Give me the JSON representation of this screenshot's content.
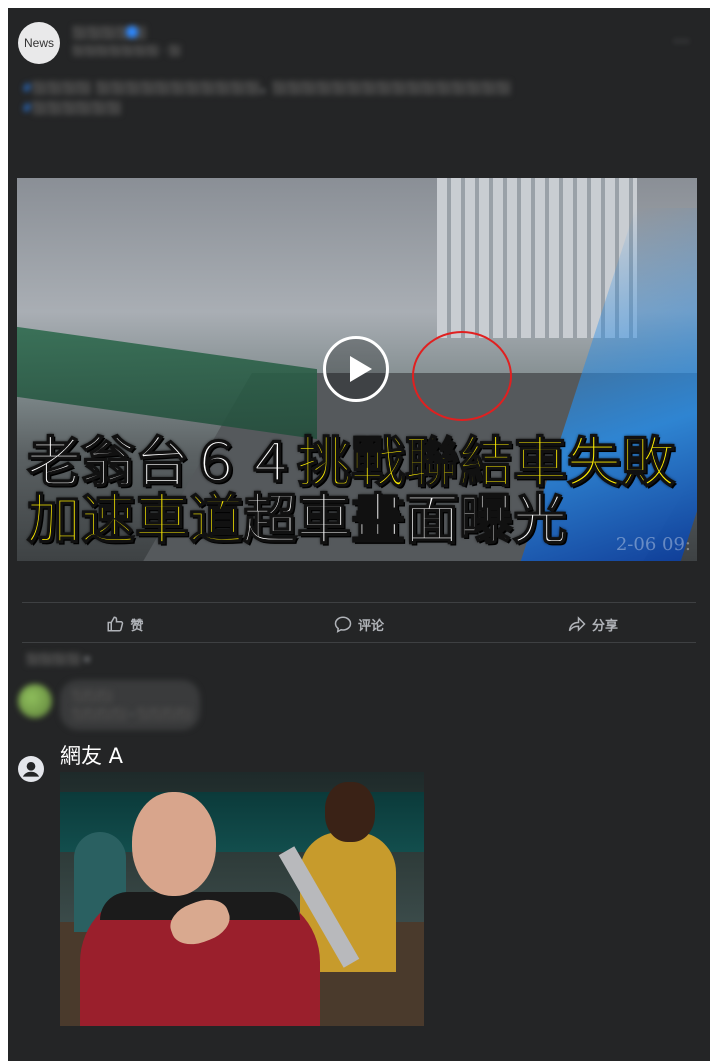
{
  "post": {
    "page_avatar_text": "News",
    "page_name": "⬛⬛⬛⬛⬛",
    "meta": "⬛⬛⬛⬛⬛⬛⬛ · ⬛",
    "more": "···",
    "text_hashtag": "#⬛⬛⬛⬛",
    "text_body": "⬛⬛⬛⬛⬛⬛⬛⬛⬛⬛⬛，⬛⬛⬛⬛⬛⬛⬛⬛⬛⬛⬛⬛⬛⬛⬛⬛",
    "text_link": "#⬛⬛⬛⬛⬛⬛"
  },
  "video": {
    "caption_line1_white": "老翁台６４",
    "caption_line1_yellow": "挑戰聯結車失敗",
    "caption_line2_yellow": "加速車道",
    "caption_line2_white": "超車畫面曝光",
    "timestamp": "2-06 09:"
  },
  "actions": {
    "like": "赞",
    "comment": "评论",
    "share": "分享"
  },
  "comments": {
    "sort_label": "⬛⬛⬛⬛ ▾",
    "first": {
      "name": "⬛⬛⬛",
      "text": "⬛⬛⬛⬛ · ⬛⬛⬛⬛"
    },
    "second": {
      "name": "網友 A"
    }
  },
  "icons": {
    "like": "thumbs-up-icon",
    "comment": "comment-bubble-icon",
    "share": "share-arrow-icon",
    "user": "user-avatar-icon",
    "play": "play-icon"
  },
  "colors": {
    "card_background": "#242526",
    "caption_yellow": "#ffee00",
    "circle_red": "#e02020",
    "hashtag_blue": "#2d88ff"
  }
}
